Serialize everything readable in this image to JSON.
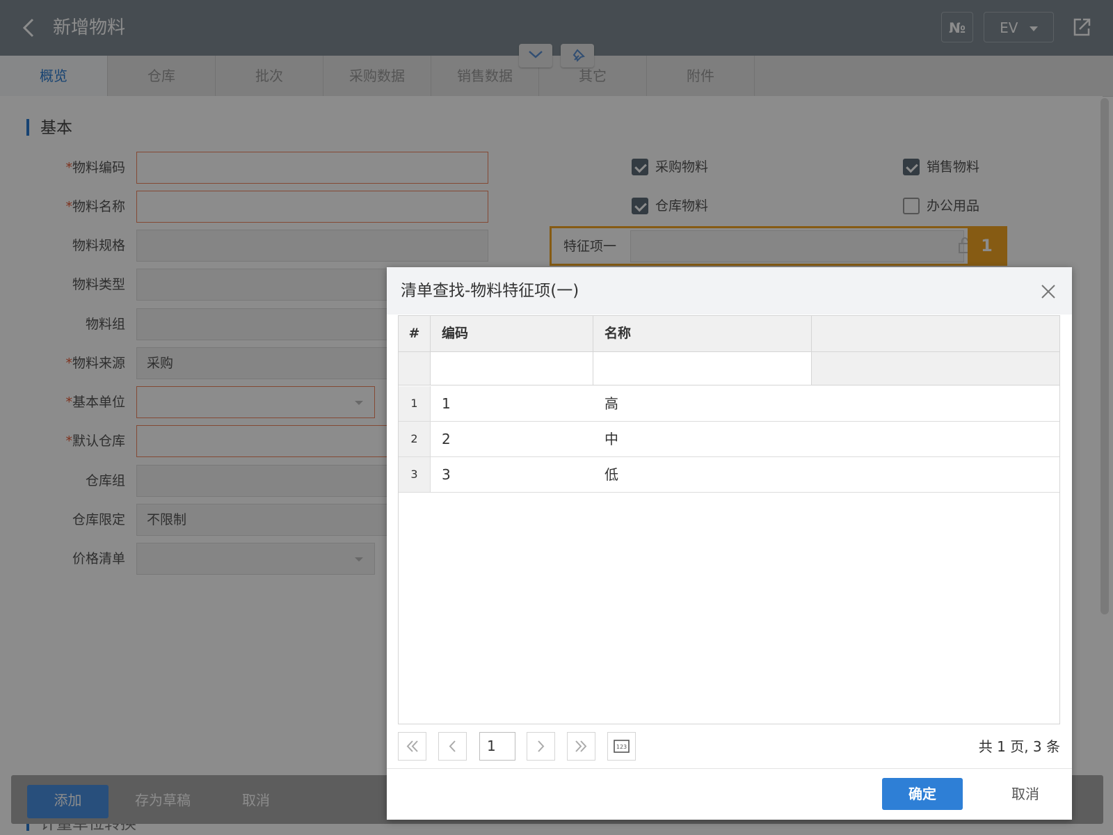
{
  "header": {
    "title": "新增物料",
    "num_label": "№",
    "lang_label": "EV"
  },
  "tabs": [
    {
      "label": "概览"
    },
    {
      "label": "仓库"
    },
    {
      "label": "批次"
    },
    {
      "label": "采购数据"
    },
    {
      "label": "销售数据"
    },
    {
      "label": "其它"
    },
    {
      "label": "附件"
    }
  ],
  "section": {
    "title": "基本"
  },
  "fields": {
    "code": {
      "label": "物料编码",
      "value": ""
    },
    "name": {
      "label": "物料名称",
      "value": ""
    },
    "spec": {
      "label": "物料规格",
      "value": ""
    },
    "type": {
      "label": "物料类型",
      "value": ""
    },
    "group": {
      "label": "物料组",
      "value": ""
    },
    "source": {
      "label": "物料来源",
      "value": "采购"
    },
    "unit": {
      "label": "基本单位",
      "value": ""
    },
    "warehouse": {
      "label": "默认仓库",
      "value": ""
    },
    "warehouse_group": {
      "label": "仓库组",
      "value": ""
    },
    "warehouse_limit": {
      "label": "仓库限定",
      "value": "不限制"
    },
    "price_list": {
      "label": "价格清单",
      "value": ""
    }
  },
  "checkboxes": {
    "purchase": {
      "label": "采购物料",
      "checked": true
    },
    "sales": {
      "label": "销售物料",
      "checked": true
    },
    "stock": {
      "label": "仓库物料",
      "checked": true
    },
    "office": {
      "label": "办公用品",
      "checked": false
    }
  },
  "feature": {
    "label": "特征项一",
    "badge": "1"
  },
  "actions": {
    "add": "添加",
    "draft": "存为草稿",
    "cancel": "取消"
  },
  "section2": {
    "title": "计量单位转换"
  },
  "dialog": {
    "title": "清单查找-物料特征项(一)",
    "columns": {
      "hash": "#",
      "code": "编码",
      "name": "名称"
    },
    "rows": [
      {
        "index": "1",
        "code": "1",
        "name": "高"
      },
      {
        "index": "2",
        "code": "2",
        "name": "中"
      },
      {
        "index": "3",
        "code": "3",
        "name": "低"
      }
    ],
    "pager": {
      "page": "1",
      "info": "共 1 页, 3 条"
    },
    "ok": "确定",
    "cancel": "取消"
  }
}
